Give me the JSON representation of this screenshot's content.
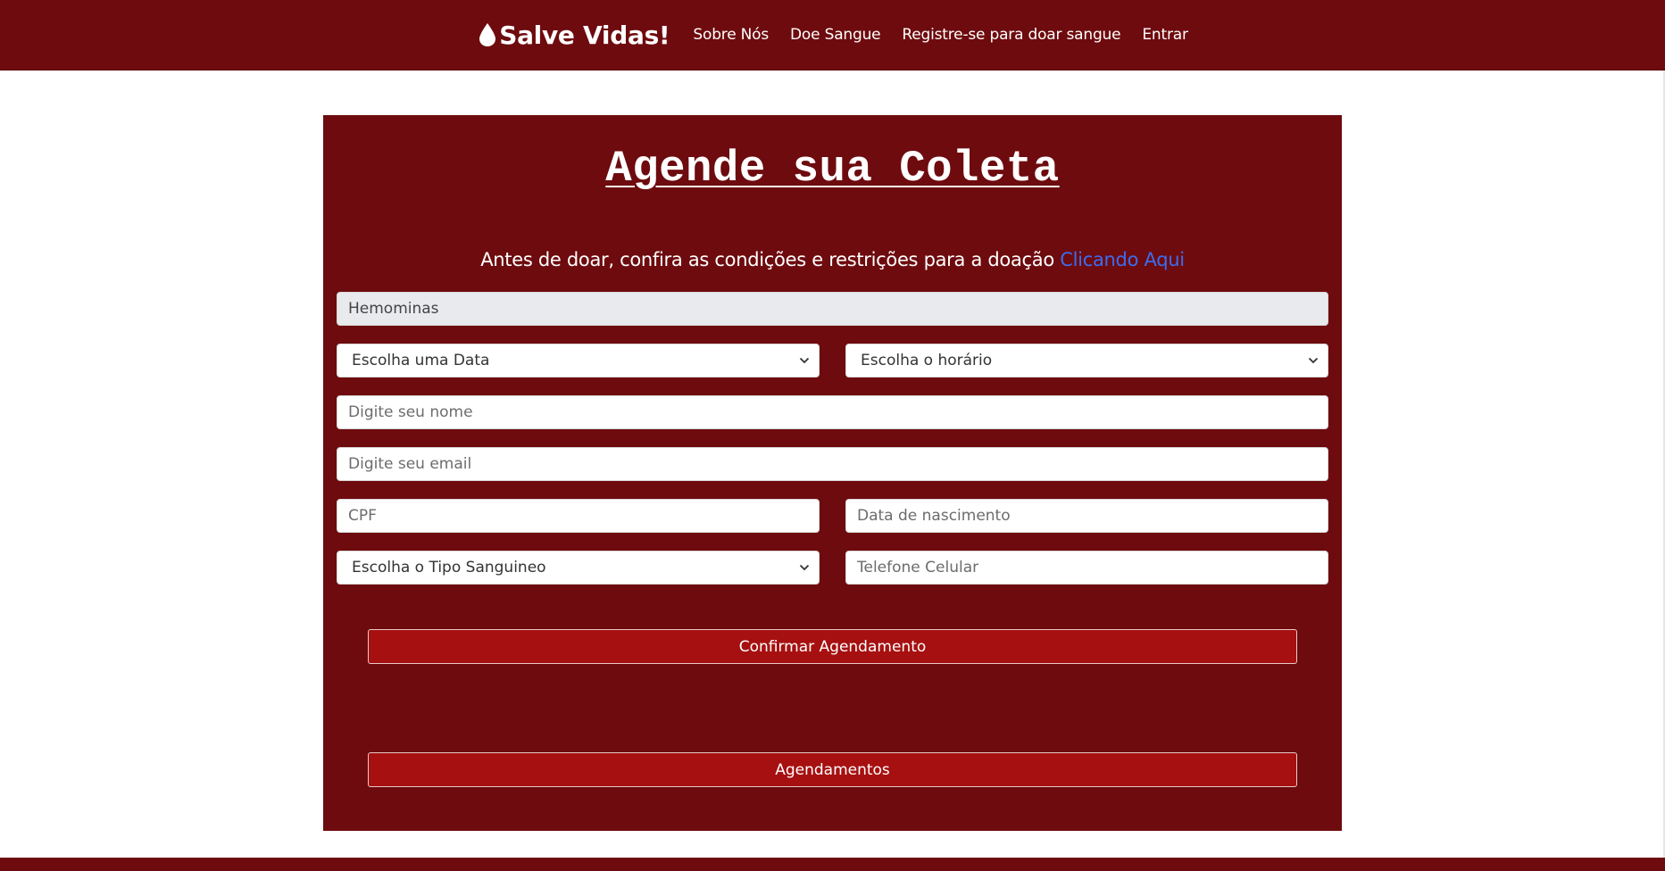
{
  "navbar": {
    "brand": "Salve Vidas!",
    "links": [
      "Sobre Nós",
      "Doe Sangue",
      "Registre-se para doar sangue",
      "Entrar"
    ]
  },
  "form": {
    "title": "Agende sua Coleta",
    "notice_text": "Antes de doar, confira as condições e restrições para a doação ",
    "notice_link": "Clicando Aqui",
    "location_value": "Hemominas",
    "date_select": "Escolha uma Data",
    "time_select": "Escolha o horário",
    "name_placeholder": "Digite seu nome",
    "email_placeholder": "Digite seu email",
    "cpf_placeholder": "CPF",
    "birthdate_placeholder": "Data de nascimento",
    "blood_type_select": "Escolha o Tipo Sanguineo",
    "phone_placeholder": "Telefone Celular",
    "confirm_button": "Confirmar Agendamento",
    "appointments_button": "Agendamentos"
  },
  "colors": {
    "brand_dark_red": "#6e0b0e",
    "button_red": "#a71010",
    "link_blue": "#3b6cf0"
  }
}
